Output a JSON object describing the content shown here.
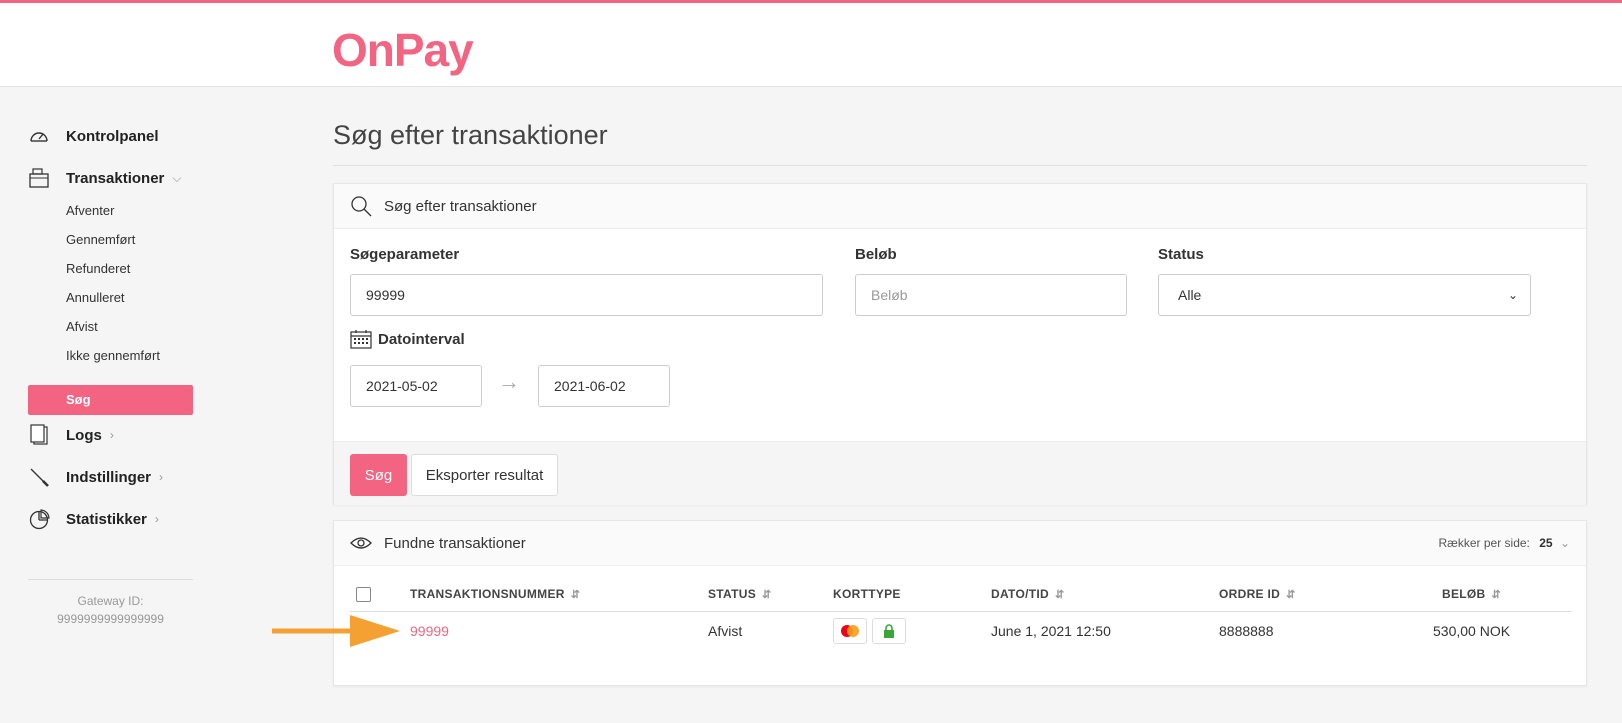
{
  "brand": {
    "logo_text": "OnPay",
    "accent": "#f36482"
  },
  "sidebar": {
    "main_items": [
      {
        "label": "Kontrolpanel",
        "icon": "speedometer-icon"
      },
      {
        "label": "Transaktioner",
        "icon": "wallet-icon"
      },
      {
        "label": "Logs",
        "icon": "documents-icon"
      },
      {
        "label": "Indstillinger",
        "icon": "wrench-icon"
      },
      {
        "label": "Statistikker",
        "icon": "pie-chart-icon"
      }
    ],
    "sub_items": [
      "Afventer",
      "Gennemført",
      "Refunderet",
      "Annulleret",
      "Afvist",
      "Ikke gennemført"
    ],
    "active_item": "Søg",
    "gateway_label": "Gateway ID:",
    "gateway_id": "9999999999999999"
  },
  "main": {
    "title": "Søg efter transaktioner",
    "search_card": {
      "header": "Søg efter transaktioner",
      "param_label": "Søgeparameter",
      "param_value": "99999",
      "amount_label": "Beløb",
      "amount_placeholder": "Beløb",
      "status_label": "Status",
      "status_value": "Alle",
      "date_label": "Datointerval",
      "date_from": "2021-05-02",
      "date_to": "2021-06-02",
      "search_button": "Søg",
      "export_button": "Eksporter resultat"
    },
    "results_card": {
      "header": "Fundne transaktioner",
      "rows_per_page_label": "Rækker per side:",
      "rows_per_page_value": "25",
      "columns": [
        "TRANSAKTIONSNUMMER",
        "STATUS",
        "KORTTYPE",
        "DATO/TID",
        "ORDRE ID",
        "BELØB"
      ],
      "rows": [
        {
          "transaction": "99999",
          "status": "Afvist",
          "datetime": "June 1, 2021 12:50",
          "order_id": "8888888",
          "amount": "530,00 NOK"
        }
      ]
    }
  }
}
